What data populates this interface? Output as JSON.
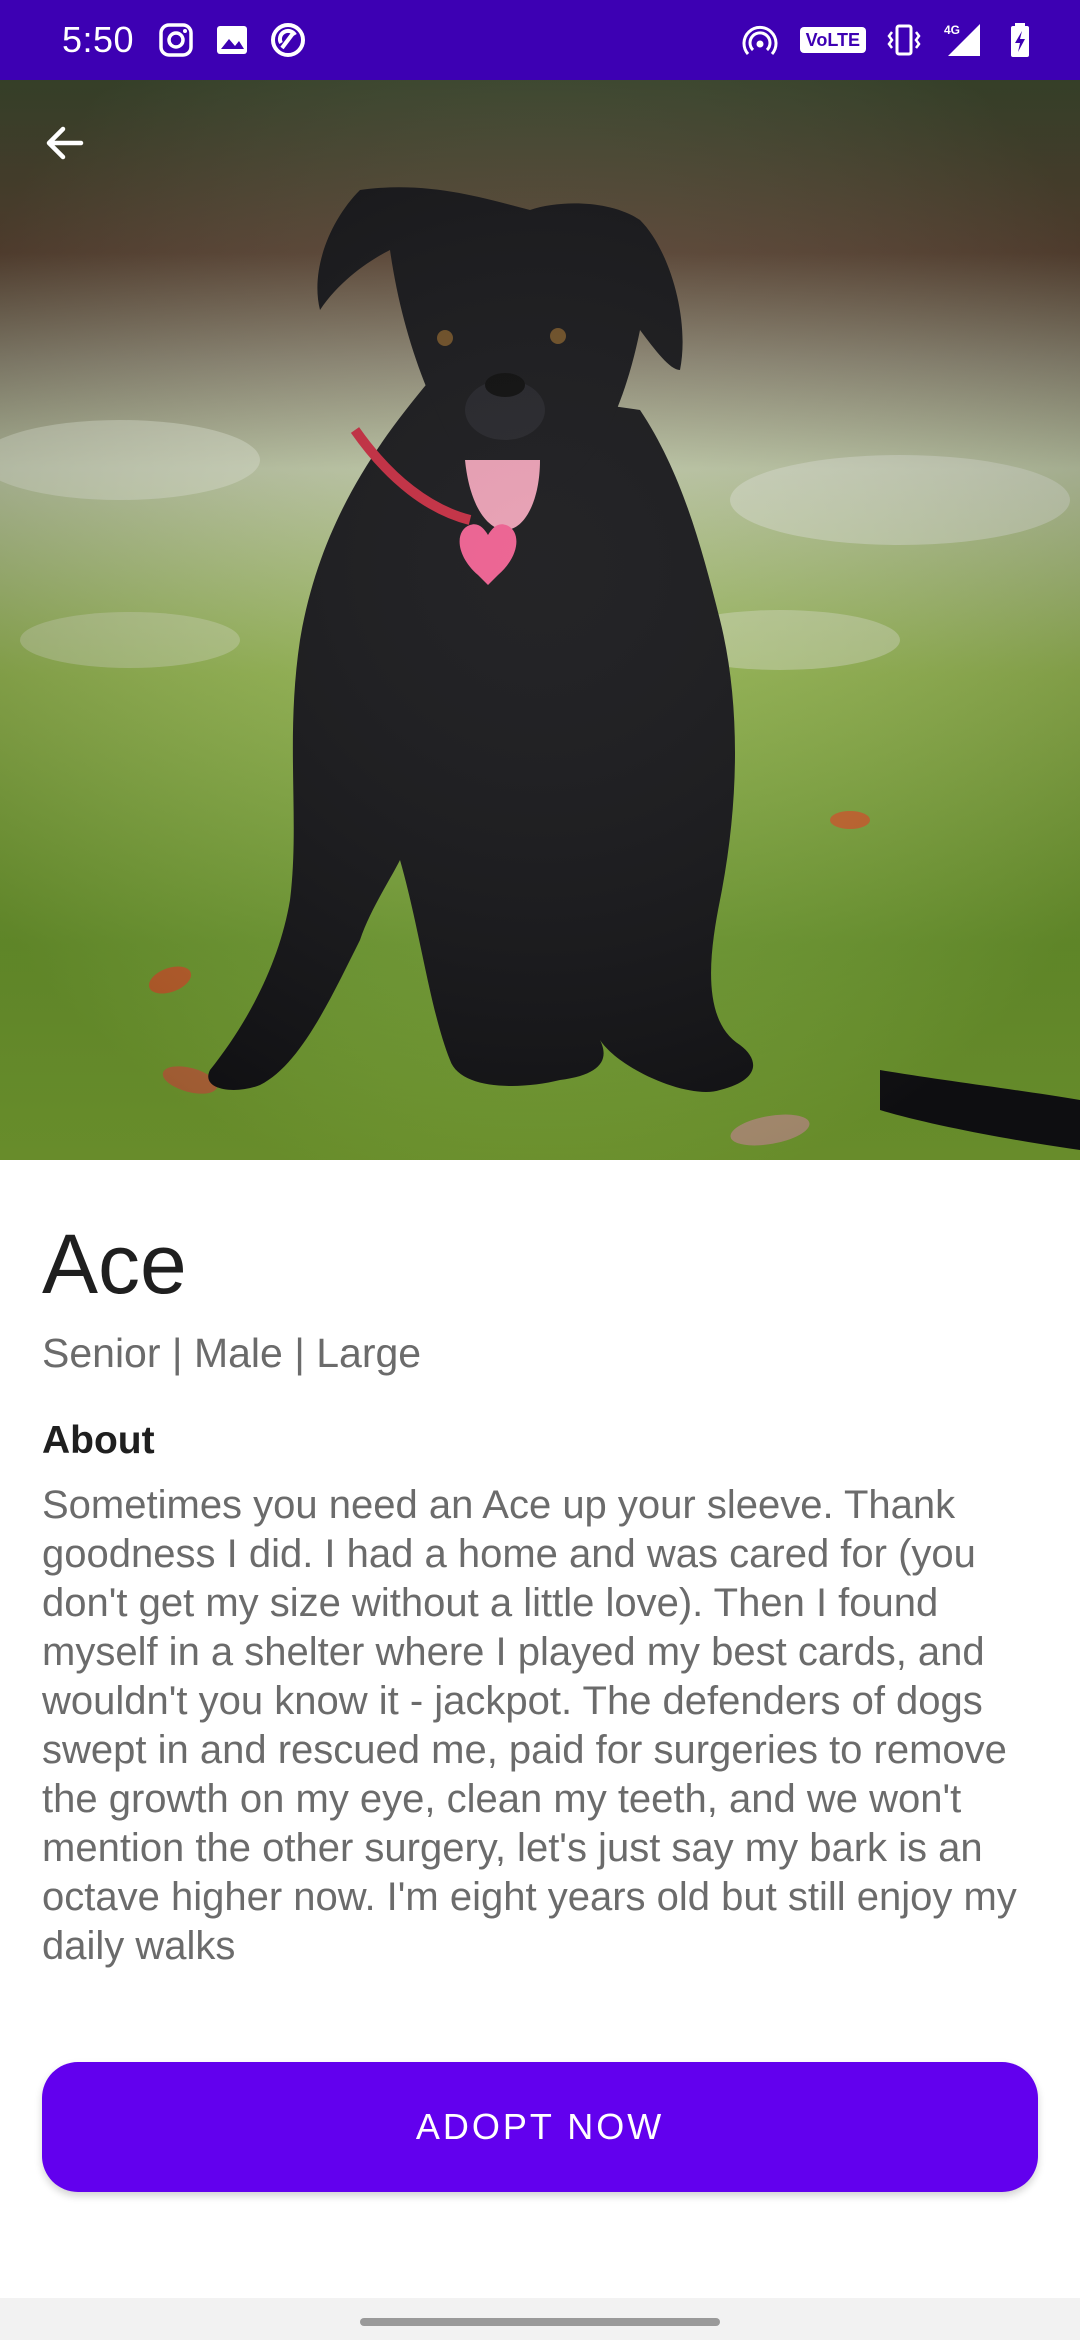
{
  "status_bar": {
    "time": "5:50",
    "left_icons": [
      "instagram-icon",
      "image-icon",
      "sync-icon"
    ],
    "right_icons": [
      "hotspot-icon",
      "volte-badge",
      "vibrate-icon",
      "signal-4g-icon",
      "battery-charging-icon"
    ],
    "volte_label": "VoLTE",
    "network_label": "4G",
    "background_color": "#3d00b3"
  },
  "toolbar": {
    "back_icon": "arrow-back-icon"
  },
  "pet": {
    "name": "Ace",
    "meta": "Senior | Male | Large",
    "about_heading": "About",
    "about_text": "Sometimes you need an Ace up your sleeve. Thank goodness I did. I had a home and was cared for (you don't get my size without a little love). Then I found myself in a shelter where I played my best cards, and wouldn't you know it - jackpot. The defenders of dogs swept in and rescued me, paid for surgeries to remove the growth on my eye, clean my teeth, and we won't mention the other surgery, let's just say my bark is an octave higher now. I'm eight years old but still enjoy my daily walks"
  },
  "actions": {
    "adopt_label": "ADOPT NOW",
    "accent_color": "#6200ee"
  }
}
